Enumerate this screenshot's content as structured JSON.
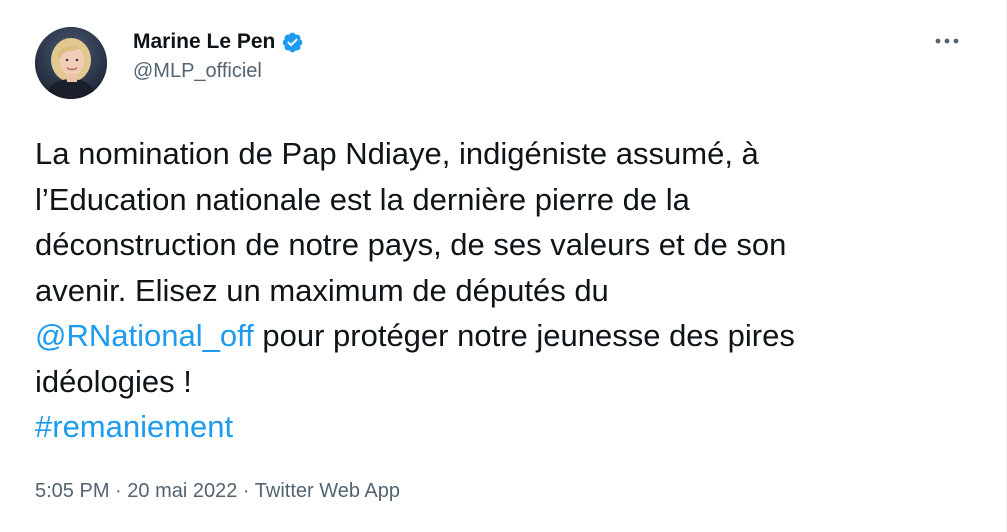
{
  "author": {
    "display_name": "Marine Le Pen",
    "handle": "@MLP_officiel",
    "verified": true
  },
  "tweet": {
    "line1": "La nomination de Pap Ndiaye, indigéniste assumé, à",
    "line2": "l’Education nationale est la dernière pierre de la",
    "line3": "déconstruction de notre pays, de ses valeurs et de son",
    "line4": "avenir. Elisez un maximum de députés du",
    "mention": "@RNational_off",
    "line5_rest": " pour protéger notre jeunesse des pires",
    "line6": "idéologies !",
    "hashtag": "#remaniement"
  },
  "meta": {
    "time": "5:05 PM",
    "separator": " · ",
    "date": "20 mai 2022",
    "source": "Twitter Web App"
  },
  "icons": {
    "verified": "verified-badge-icon",
    "more": "more-options-icon"
  },
  "colors": {
    "link": "#1d9bf0",
    "text": "#0f1419",
    "secondary": "#536471",
    "verified": "#1d9bf0"
  }
}
